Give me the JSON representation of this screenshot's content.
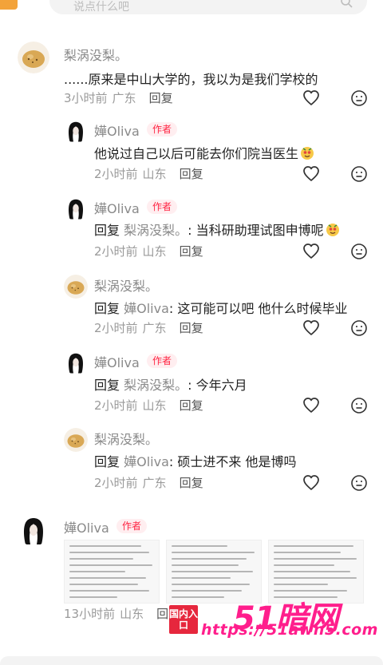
{
  "colors": {
    "author_red": "#ff2442",
    "gray_text": "#8a8a8a",
    "watermark_pink": "#ff1e8c"
  },
  "search": {
    "placeholder": "说点什么吧"
  },
  "comments": [
    {
      "name": "梨涡没梨。",
      "text": "......原来是中山大学的，我以为是我们学校的",
      "time": "3小时前",
      "location": "广东",
      "reply": "回复"
    },
    {
      "name": "嬅Oliva",
      "tag": "作者",
      "text": "他说过自己以后可能去你们院当医生",
      "time": "2小时前",
      "location": "山东",
      "reply": "回复"
    },
    {
      "name": "嬅Oliva",
      "tag": "作者",
      "reply_word": "回复",
      "mention": "梨涡没梨。",
      "text": ": 当科研助理试图申博呢",
      "time": "2小时前",
      "location": "山东",
      "reply": "回复"
    },
    {
      "name": "梨涡没梨。",
      "reply_word": "回复",
      "mention": "嬅Oliva",
      "text": ": 这可能可以吧  他什么时候毕业",
      "time": "2小时前",
      "location": "广东",
      "reply": "回复"
    },
    {
      "name": "嬅Oliva",
      "tag": "作者",
      "reply_word": "回复",
      "mention": "梨涡没梨。",
      "text": ": 今年六月",
      "time": "2小时前",
      "location": "山东",
      "reply": "回复"
    },
    {
      "name": "梨涡没梨。",
      "reply_word": "回复",
      "mention": "嬅Oliva",
      "text": ": 硕士进不来 他是博吗",
      "time": "2小时前",
      "location": "广东",
      "reply": "回复"
    },
    {
      "name": "嬅Oliva",
      "tag": "作者",
      "time": "13小时前",
      "location": "山东",
      "reply": "回复"
    }
  ],
  "watermark": {
    "gate": "国内入口",
    "logo": "51暗网",
    "url": "https://51awn5.com"
  },
  "icons": {
    "like": "heart-outline-icon",
    "dislike": "meh-face-icon",
    "search": "search-icon"
  }
}
